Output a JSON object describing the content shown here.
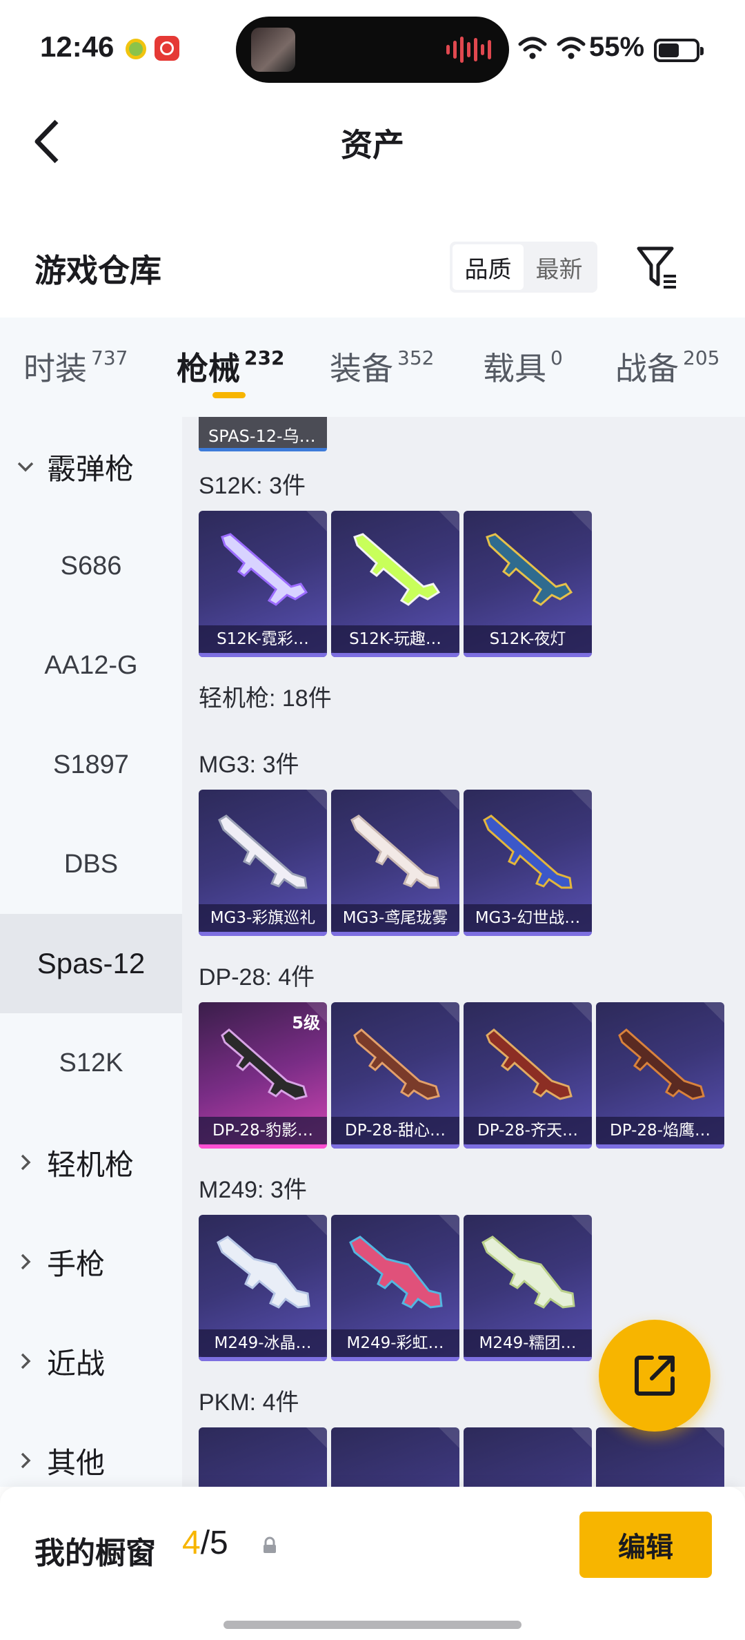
{
  "status": {
    "time": "12:46",
    "battery": "55%",
    "battery_level": 0.55
  },
  "header": {
    "title": "资产"
  },
  "warehouse": {
    "title": "游戏仓库",
    "sort_options": [
      "品质",
      "最新"
    ],
    "sort_selected": "品质"
  },
  "tabs": [
    {
      "label": "时装",
      "count": "737"
    },
    {
      "label": "枪械",
      "count": "232",
      "active": true
    },
    {
      "label": "装备",
      "count": "352"
    },
    {
      "label": "载具",
      "count": "0"
    },
    {
      "label": "战备",
      "count": "205"
    }
  ],
  "sidebar": {
    "shotgun_category": "霰弹枪",
    "items": [
      "S686",
      "AA12-G",
      "S1897",
      "DBS",
      "Spas-12",
      "S12K"
    ],
    "selected": "Spas-12",
    "categories": [
      "轻机枪",
      "手枪",
      "近战",
      "其他"
    ]
  },
  "content": {
    "partial_tag": "SPAS-12-乌…",
    "groups": [
      {
        "title": "S12K: 3件",
        "items": [
          {
            "label": "S12K-霓彩…",
            "icon": "rifle-icon"
          },
          {
            "label": "S12K-玩趣…",
            "icon": "rifle-icon"
          },
          {
            "label": "S12K-夜灯",
            "icon": "rifle-icon"
          }
        ]
      },
      {
        "title": "轻机枪: 18件",
        "items": []
      },
      {
        "title": "MG3: 3件",
        "items": [
          {
            "label": "MG3-彩旗巡礼",
            "icon": "machine-gun-icon"
          },
          {
            "label": "MG3-鸢尾珑雾",
            "icon": "machine-gun-icon"
          },
          {
            "label": "MG3-幻世战…",
            "icon": "machine-gun-icon"
          }
        ]
      },
      {
        "title": "DP-28: 4件",
        "items": [
          {
            "label": "DP-28-豹影…",
            "icon": "lmg-icon",
            "level": "5级",
            "rarity": "pink"
          },
          {
            "label": "DP-28-甜心…",
            "icon": "lmg-icon"
          },
          {
            "label": "DP-28-齐天…",
            "icon": "lmg-icon"
          },
          {
            "label": "DP-28-焰鹰…",
            "icon": "lmg-icon"
          }
        ]
      },
      {
        "title": "M249: 3件",
        "items": [
          {
            "label": "M249-冰晶…",
            "icon": "heavy-gun-icon"
          },
          {
            "label": "M249-彩虹…",
            "icon": "heavy-gun-icon"
          },
          {
            "label": "M249-糯团…",
            "icon": "heavy-gun-icon"
          }
        ]
      },
      {
        "title": "PKM: 4件",
        "items": []
      }
    ]
  },
  "showcase": {
    "title": "我的橱窗",
    "current": "4",
    "total": "/5",
    "edit_label": "编辑"
  },
  "colors": {
    "accent": "#f7b500",
    "card_purple": "#3b3678",
    "card_pink": "#d447b4"
  }
}
